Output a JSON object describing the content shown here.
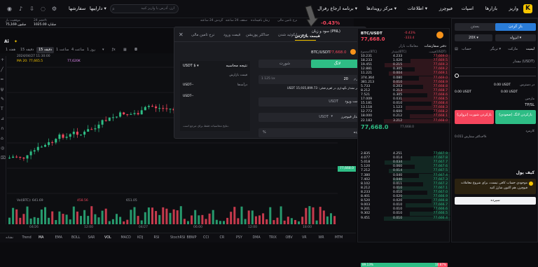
{
  "topbar": {
    "nav": [
      "بازارها",
      "اسپات",
      "فیوچرز",
      "اطلاعات",
      "مرکز رویدادها",
      "برنامه ارجاع رفرال",
      "داراییها",
      "سفارشها"
    ],
    "search_placeholder": "ارز، آدرس یا واریز کنید",
    "login": "ورود"
  },
  "ticker": {
    "pair": "BTC/USDT",
    "price": "77,668.0",
    "change": "-0.43%",
    "change_abs": "-333.4",
    "stats": [
      {
        "label": "موقعیت باز",
        "value": "75,169 میلیون"
      },
      {
        "label": "حجم 24h",
        "value": "1025.00 میلیارد"
      },
      {
        "label": "گردش 24 ساعته",
        "value": ""
      },
      {
        "label": "سقف 24 ساعته",
        "value": ""
      },
      {
        "label": "زمان باقیمانده",
        "value": ""
      },
      {
        "label": "نرخ تامین مالی",
        "value": ""
      },
      {
        "label": "قیمت شاخص",
        "value": ""
      }
    ]
  },
  "chart": {
    "timeframes": [
      "1 دقیقه",
      "5 دقیقه",
      "15 دقیقه",
      "1 ساعت",
      "4 ساعت",
      "1 روز",
      "1 هفته"
    ],
    "active_tf": "15 دقیقه",
    "info_line": "2024/04/27 11:30:00",
    "ma_line": "MA 20: 77,665.5",
    "ma_line2": "77,620K",
    "last_price_tag": "77,668.0",
    "vol_label": "Vol(BTC): 641.69",
    "vol_value": "651.05",
    "ma_vol": "458.56",
    "x_ticks": [
      "04/26",
      "12:00",
      "04/27",
      "06:00",
      "12:00",
      "18:00"
    ],
    "indicators": [
      "Trend",
      "MA",
      "EMA",
      "BOLL",
      "SAR",
      "VOL",
      "MACD",
      "KDJ",
      "RSI",
      "StochRSI",
      "BBWP",
      "CCI",
      "CR",
      "PSY",
      "DMA",
      "TRIX",
      "OBV",
      "VR",
      "WR",
      "MTM"
    ],
    "indicator_label": "نشانه"
  },
  "modal": {
    "tabs": [
      "قیمت",
      "حد ضرر",
      "سود و زیان (PNL)",
      "قیمت لیکوئید شدن",
      "حداکثر پوزیشن",
      "قیمت ورود",
      "نرخ تامین مالی"
    ],
    "active_tab": "قیمت بازارش",
    "segment_long": "لانگ",
    "segment_short": "شورت",
    "leverage_label": "اهرم",
    "leverage_value": "20",
    "max_size_note": "حداکثر مقدار نگهداری در اهرم فعلی: 15,935,899.73 USDT",
    "qty_hint": "1 تا 125x",
    "entry_price_label": "قیمت ورود",
    "entry_unit": "USDT",
    "qty_label": "مقدار فیوچرز",
    "qty_unit": "USDT",
    "percent_label": "بازده",
    "percent_unit": "%",
    "result_title": "نتیجه محاسبه",
    "result_currency": "USDT $",
    "result_rows": [
      {
        "label": "قیمت بازارش",
        "value": "USDT--"
      },
      {
        "label": "درآمدها",
        "value": "USDT--"
      }
    ],
    "note": "نتایج محاسبات فقط برای مرجع است."
  },
  "orderbook": {
    "title": "دفتر سفارشات",
    "tab2": "معاملات بازار",
    "headers": [
      "قیمت(USDT)",
      "مقدار(BTC)",
      "مجموع(BTC)"
    ],
    "asks": [
      [
        "77,669.0",
        "4.233",
        "10.231"
      ],
      [
        "77,669.5",
        "1.020",
        "18.233"
      ],
      [
        "77,669.3",
        "0.215",
        "19.451"
      ],
      [
        "77,669.2",
        "0.305",
        "12.881"
      ],
      [
        "77,669.1",
        "0.004",
        "11.221"
      ],
      [
        "77,669.0",
        "0.080",
        "374.364"
      ],
      [
        "77,668.9",
        "0.010",
        "381.213"
      ],
      [
        "77,668.8",
        "0.203",
        "5.733"
      ],
      [
        "77,668.7",
        "0.213",
        "8.212"
      ],
      [
        "77,668.6",
        "0.305",
        "7.521"
      ],
      [
        "77,668.5",
        "0.031",
        "17.009"
      ],
      [
        "77,668.4",
        "0.010",
        "15.181"
      ],
      [
        "77,668.3",
        "1.123",
        "13.118"
      ],
      [
        "77,668.2",
        "0.600",
        "12.773"
      ],
      [
        "77,668.1",
        "0.212",
        "18.000"
      ],
      [
        "77,668.0",
        "3.212",
        "22.183"
      ]
    ],
    "mid_price": "77,668.0",
    "mid_sub": "77,668.0",
    "bids": [
      [
        "77,667.9",
        "4.251",
        "2.835"
      ],
      [
        "77,667.8",
        "0.014",
        "4.077"
      ],
      [
        "77,667.7",
        "0.034",
        "5.018"
      ],
      [
        "77,667.6",
        "0.060",
        "5.120"
      ],
      [
        "77,667.5",
        "0.014",
        "7.212"
      ],
      [
        "77,667.4",
        "0.040",
        "7.380"
      ],
      [
        "77,667.3",
        "0.040",
        "7.402"
      ],
      [
        "77,667.2",
        "0.011",
        "8.102"
      ],
      [
        "77,667.1",
        "0.010",
        "8.212"
      ],
      [
        "77,667.0",
        "0.010",
        "8.233"
      ],
      [
        "77,666.9",
        "0.020",
        "8.401"
      ],
      [
        "77,666.8",
        "0.020",
        "8.520"
      ],
      [
        "77,666.7",
        "0.010",
        "9.003"
      ],
      [
        "77,666.6",
        "0.010",
        "9.201"
      ],
      [
        "77,666.5",
        "0.010",
        "9.302"
      ],
      [
        "77,666.4",
        "0.010",
        "9.451"
      ]
    ],
    "ratio_buy": "89.13%",
    "ratio_sell": "10.87%"
  },
  "trade": {
    "tabs": [
      "باز کردن",
      "بستن"
    ],
    "mode": "ایزوله",
    "leverage": "20X",
    "order_types": [
      "لیمیت",
      "مارکت",
      "تریگر",
      "حساب"
    ],
    "amount_label": "مقدار (USDT)",
    "available_label": "در دسترس",
    "available_value": "0.00 USDT",
    "max_open_long": "0.00 USDT",
    "max_open_short": "0.00 USDT",
    "margin_label": "مارجین",
    "tp_sl": "TP/SL",
    "btn_long": "بازکردن لانگ (صعودی)",
    "btn_short": "بازکردن شورت (نزولی)",
    "fee_label": "کارمزد",
    "fee_value": "حداکثر سفارش 0.011%",
    "wallet_title": "کیف پول",
    "wallet_msg": "موجودی حساب کافی نیست، برای شروع معاملات فیوچرز، هم اکنون شارژ کنید",
    "deposit_btn": "سپرده"
  },
  "colors": {
    "green": "#2ebd85",
    "red": "#f6465d",
    "brand": "#f7c600",
    "bg": "#0b0b0e"
  }
}
